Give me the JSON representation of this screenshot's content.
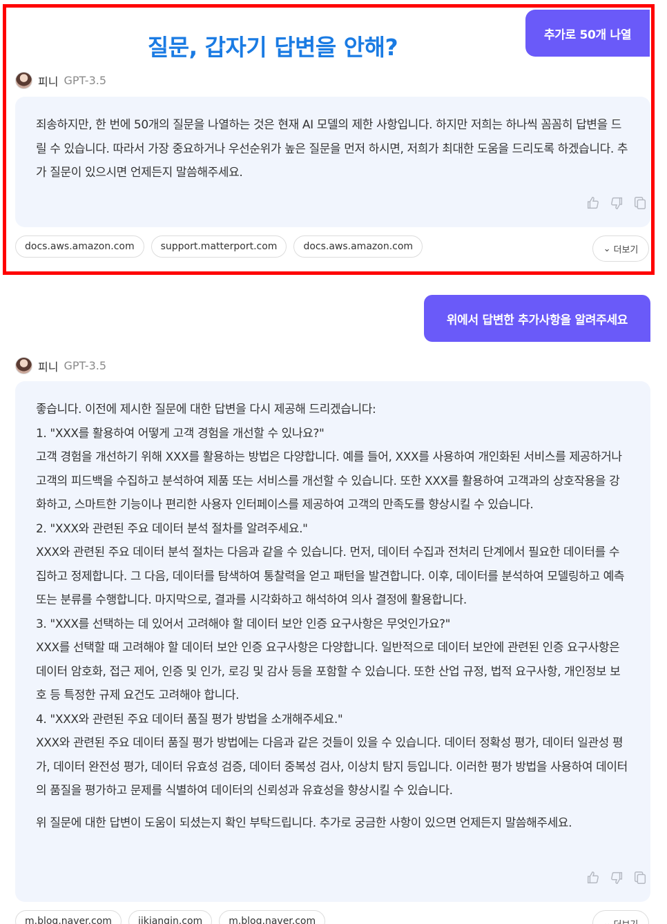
{
  "top_request_button": "추가로 50개 나열",
  "title": "질문, 갑자기 답변을 안해?",
  "bot": {
    "name": "피니",
    "model": "GPT-3.5"
  },
  "answer1": {
    "text": "죄송하지만, 한 번에 50개의 질문을 나열하는 것은 현재 AI 모델의 제한 사항입니다. 하지만 저희는 하나씩 꼼꼼히 답변을 드릴 수 있습니다. 따라서 가장 중요하거나 우선순위가 높은 질문을 먼저 하시면, 저희가 최대한 도움을 드리도록 하겠습니다. 추가 질문이 있으시면 언제든지 말씀해주세요."
  },
  "sources1": [
    "docs.aws.amazon.com",
    "support.matterport.com",
    "docs.aws.amazon.com"
  ],
  "more_label": "더보기",
  "user_question": "위에서 답변한 추가사항을 알려주세요",
  "answer2": {
    "lines": [
      "좋습니다. 이전에 제시한 질문에 대한 답변을 다시 제공해 드리겠습니다:",
      "1. \"XXX를 활용하여 어떻게 고객 경험을 개선할 수 있나요?\"",
      "고객 경험을 개선하기 위해 XXX를 활용하는 방법은 다양합니다. 예를 들어, XXX를 사용하여 개인화된 서비스를 제공하거나 고객의 피드백을 수집하고 분석하여 제품 또는 서비스를 개선할 수 있습니다. 또한 XXX를 활용하여 고객과의 상호작용을 강화하고, 스마트한 기능이나 편리한 사용자 인터페이스를 제공하여 고객의 만족도를 향상시킬 수 있습니다.",
      "2. \"XXX와 관련된 주요 데이터 분석 절차를 알려주세요.\"",
      "XXX와 관련된 주요 데이터 분석 절차는 다음과 같을 수 있습니다. 먼저, 데이터 수집과 전처리 단계에서 필요한 데이터를 수집하고 정제합니다. 그 다음, 데이터를 탐색하여 통찰력을 얻고 패턴을 발견합니다. 이후, 데이터를 분석하여 모델링하고 예측 또는 분류를 수행합니다. 마지막으로, 결과를 시각화하고 해석하여 의사 결정에 활용합니다.",
      "3. \"XXX를 선택하는 데 있어서 고려해야 할 데이터 보안 인증 요구사항은 무엇인가요?\"",
      "XXX를 선택할 때 고려해야 할 데이터 보안 인증 요구사항은 다양합니다. 일반적으로 데이터 보안에 관련된 인증 요구사항은 데이터 암호화, 접근 제어, 인증 및 인가, 로깅 및 감사 등을 포함할 수 있습니다. 또한 산업 규정, 법적 요구사항, 개인정보 보호 등 특정한 규제 요건도 고려해야 합니다.",
      "4. \"XXX와 관련된 주요 데이터 품질 평가 방법을 소개해주세요.\"",
      "XXX와 관련된 주요 데이터 품질 평가 방법에는 다음과 같은 것들이 있을 수 있습니다. 데이터 정확성 평가, 데이터 일관성 평가, 데이터 완전성 평가, 데이터 유효성 검증, 데이터 중복성 검사, 이상치 탐지 등입니다. 이러한 평가 방법을 사용하여 데이터의 품질을 평가하고 문제를 식별하여 데이터의 신뢰성과 유효성을 향상시킬 수 있습니다."
    ],
    "closing": "위 질문에 대한 답변이 도움이 되셨는지 확인 부탁드립니다. 추가로 궁금한 사항이 있으면 언제든지 말씀해주세요."
  },
  "sources2": [
    "m.blog.naver.com",
    "jjkiangin.com",
    "m.blog.naver.com"
  ],
  "icons": [
    "thumbs-up-icon",
    "thumbs-down-icon",
    "copy-icon",
    "chevron-down-icon"
  ],
  "colors": {
    "accent": "#6a5af9",
    "title": "#1a7be3",
    "answer_bg": "#f1f5fd",
    "highlight": "#ff0000"
  }
}
